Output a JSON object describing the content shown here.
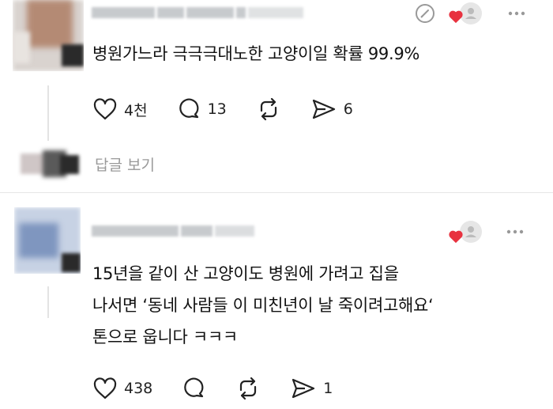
{
  "comment1": {
    "text": "병원가느라 극극극대노한 고양이일 확률 99.9%",
    "likes": "4천",
    "comments": "13",
    "shares": "6"
  },
  "view_replies_label": "답글 보기",
  "comment2": {
    "lines": [
      "15년을 같이 산 고양이도 병원에 가려고 집을",
      "나서면 ‘동네 사람들 이 미친년이 날 죽이려고해요‘",
      "톤으로 웁니다 ㅋㅋㅋ"
    ],
    "likes": "438",
    "shares": "1"
  },
  "icons": [
    "heart-icon",
    "comment-icon",
    "repost-icon",
    "share-icon",
    "edit-icon",
    "more-icon",
    "heart-badge-icon"
  ],
  "colors": {
    "accent_red": "#e8323f",
    "text": "#111111",
    "muted": "#999999"
  }
}
